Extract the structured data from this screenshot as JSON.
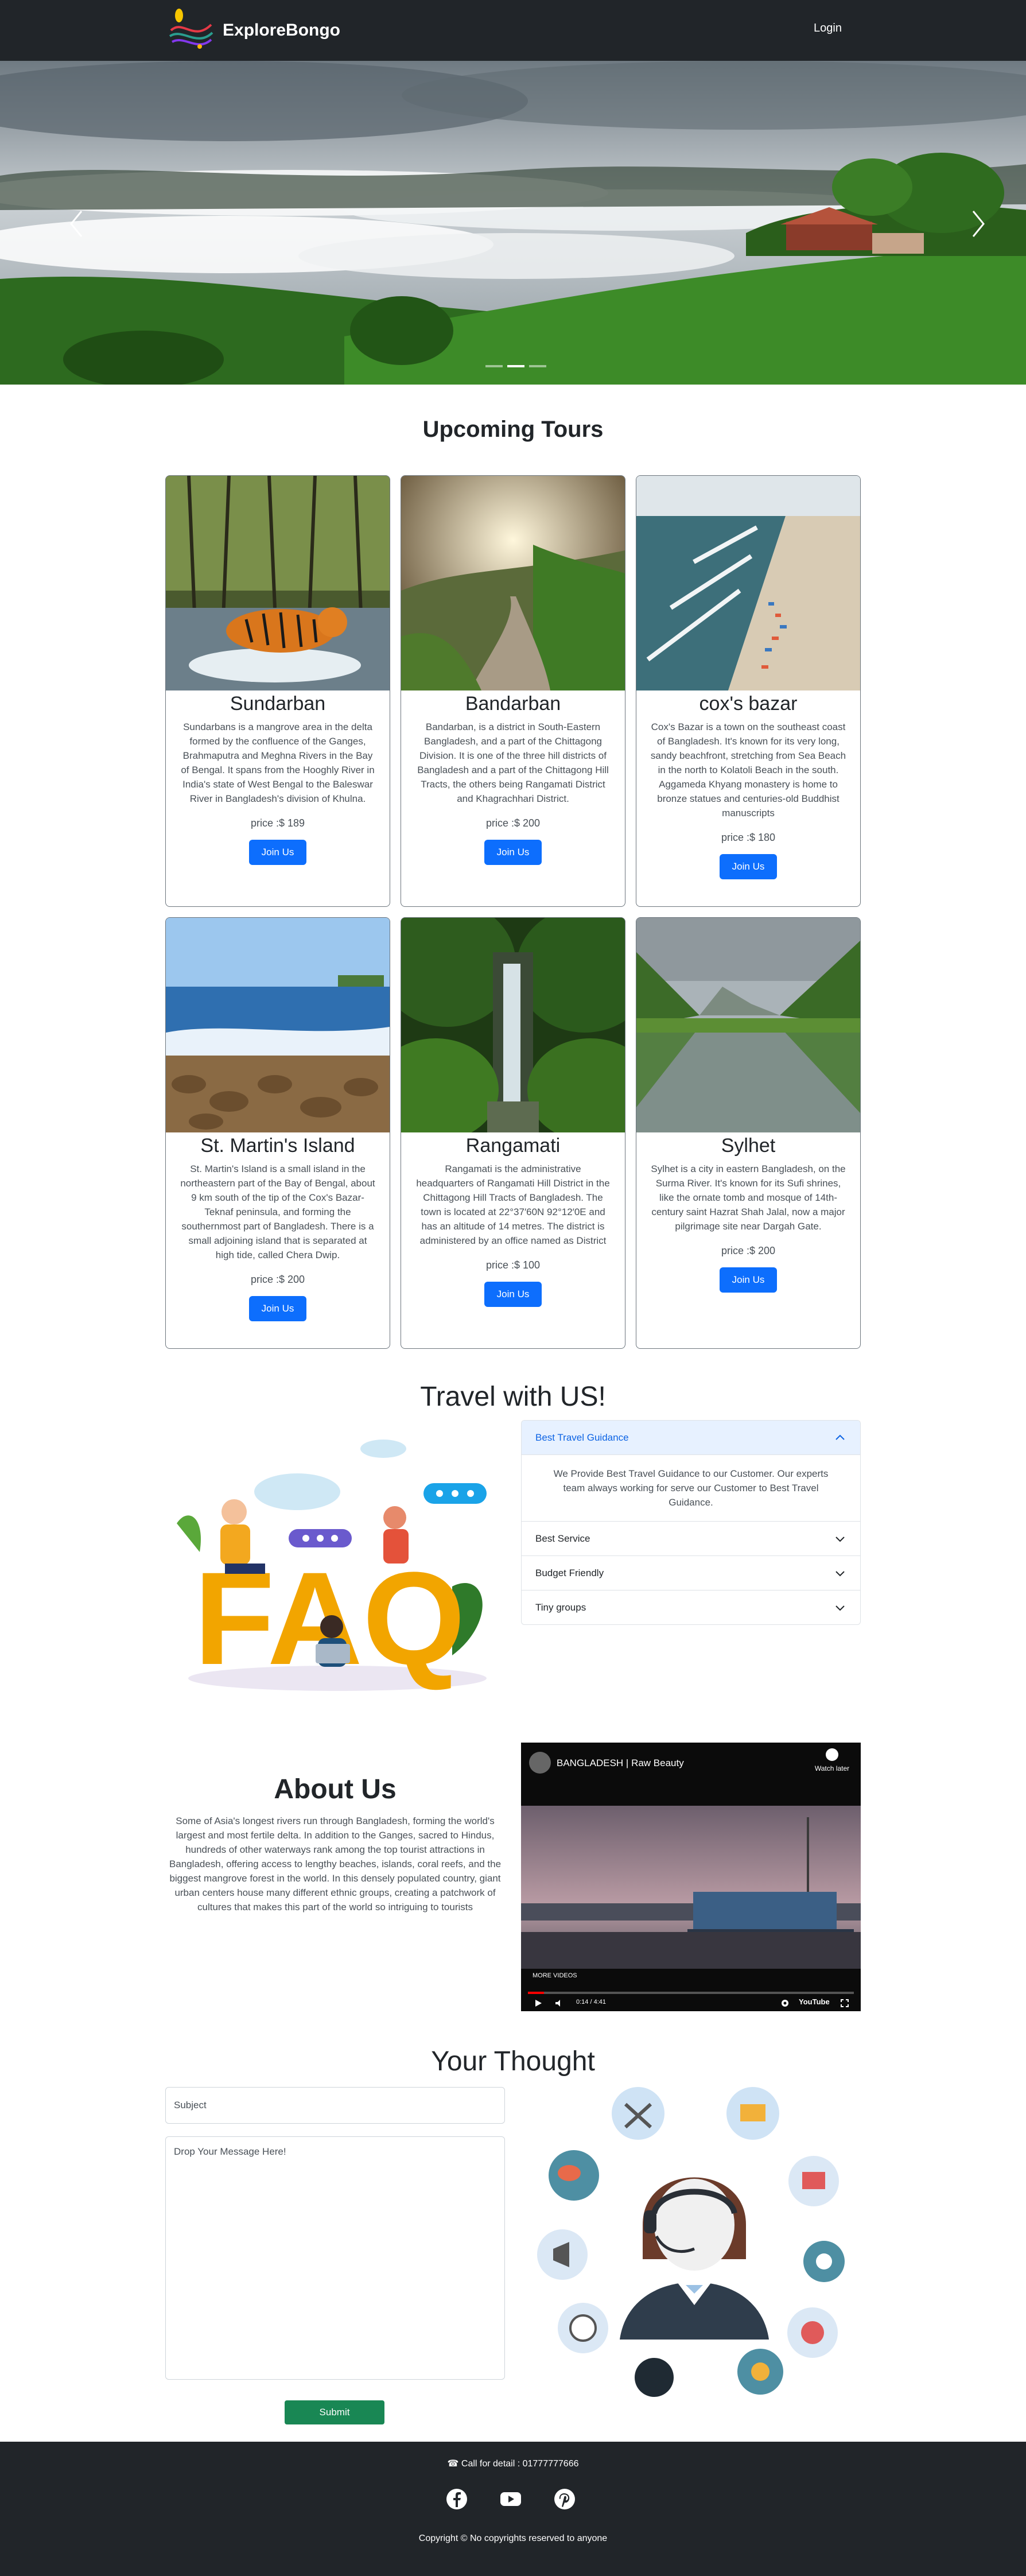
{
  "navbar": {
    "brand": "ExploreBongo",
    "login": "Login",
    "logo_icon": "travel-logo-icon"
  },
  "hero": {
    "prev_icon": "chevron-left-icon",
    "next_icon": "chevron-right-icon",
    "slide_count": 3,
    "active_slide": 1
  },
  "tours": {
    "title": "Upcoming Tours",
    "join_label": "Join Us",
    "items": [
      {
        "name": "Sundarban",
        "description": "Sundarbans is a mangrove area in the delta formed by the confluence of the Ganges, Brahmaputra and Meghna Rivers in the Bay of Bengal. It spans from the Hooghly River in India's state of West Bengal to the Baleswar River in Bangladesh's division of Khulna.",
        "price": "price :$ 189"
      },
      {
        "name": "Bandarban",
        "description": "Bandarban, is a district in South-Eastern Bangladesh, and a part of the Chittagong Division. It is one of the three hill districts of Bangladesh and a part of the Chittagong Hill Tracts, the others being Rangamati District and Khagrachhari District.",
        "price": "price :$ 200"
      },
      {
        "name": "cox's bazar",
        "description": "Cox's Bazar is a town on the southeast coast of Bangladesh. It's known for its very long, sandy beachfront, stretching from Sea Beach in the north to Kolatoli Beach in the south. Aggameda Khyang monastery is home to bronze statues and centuries-old Buddhist manuscripts",
        "price": "price :$ 180"
      },
      {
        "name": "St. Martin's Island",
        "description": "St. Martin's Island is a small island in the northeastern part of the Bay of Bengal, about 9 km south of the tip of the Cox's Bazar-Teknaf peninsula, and forming the southernmost part of Bangladesh. There is a small adjoining island that is separated at high tide, called Chera Dwip.",
        "price": "price :$ 200"
      },
      {
        "name": "Rangamati",
        "description": "Rangamati is the administrative headquarters of Rangamati Hill District in the Chittagong Hill Tracts of Bangladesh. The town is located at 22°37′60N 92°12′0E and has an altitude of 14 metres. The district is administered by an office named as District",
        "price": "price :$ 100"
      },
      {
        "name": "Sylhet",
        "description": "Sylhet is a city in eastern Bangladesh, on the Surma River. It's known for its Sufi shrines, like the ornate tomb and mosque of 14th-century saint Hazrat Shah Jalal, now a major pilgrimage site near Dargah Gate.",
        "price": "price :$ 200"
      }
    ]
  },
  "faq": {
    "title": "Travel with US!",
    "illustration_text": "FAQ",
    "items": [
      {
        "question": "Best Travel Guidance",
        "answer": "We Provide Best Travel Guidance to our Customer. Our experts team always working for serve our Customer to Best Travel Guidance.",
        "open": true
      },
      {
        "question": "Best Service",
        "open": false
      },
      {
        "question": "Budget Friendly",
        "open": false
      },
      {
        "question": "Tiny groups",
        "open": false
      }
    ]
  },
  "about": {
    "title": "About Us",
    "text": "Some of Asia's longest rivers run through Bangladesh, forming the world's largest and most fertile delta. In addition to the Ganges, sacred to Hindus, hundreds of other waterways rank among the top tourist attractions in Bangladesh, offering access to lengthy beaches, islands, coral reefs, and the biggest mangrove forest in the world. In this densely populated country, giant urban centers house many different ethnic groups, creating a patchwork of cultures that makes this part of the world so intriguing to tourists",
    "video": {
      "title": "BANGLADESH | Raw Beauty",
      "watch_later": "Watch later",
      "more_videos": "MORE VIDEOS",
      "time": "0:14 / 4:41",
      "platform": "YouTube",
      "progress": 0.05
    }
  },
  "thought": {
    "title": "Your Thought",
    "subject_placeholder": "Subject",
    "message_placeholder": "Drop Your Message Here!",
    "submit": "Submit"
  },
  "footer": {
    "call": "Call for detail : 01777777666",
    "copyright": "Copyright © No copyrights reserved to anyone",
    "social": [
      "facebook-icon",
      "youtube-icon",
      "pinterest-icon"
    ]
  },
  "colors": {
    "navbar": "#212529",
    "primary": "#0d6efd",
    "success": "#198754",
    "accordion_active_bg": "#e7f1ff"
  }
}
